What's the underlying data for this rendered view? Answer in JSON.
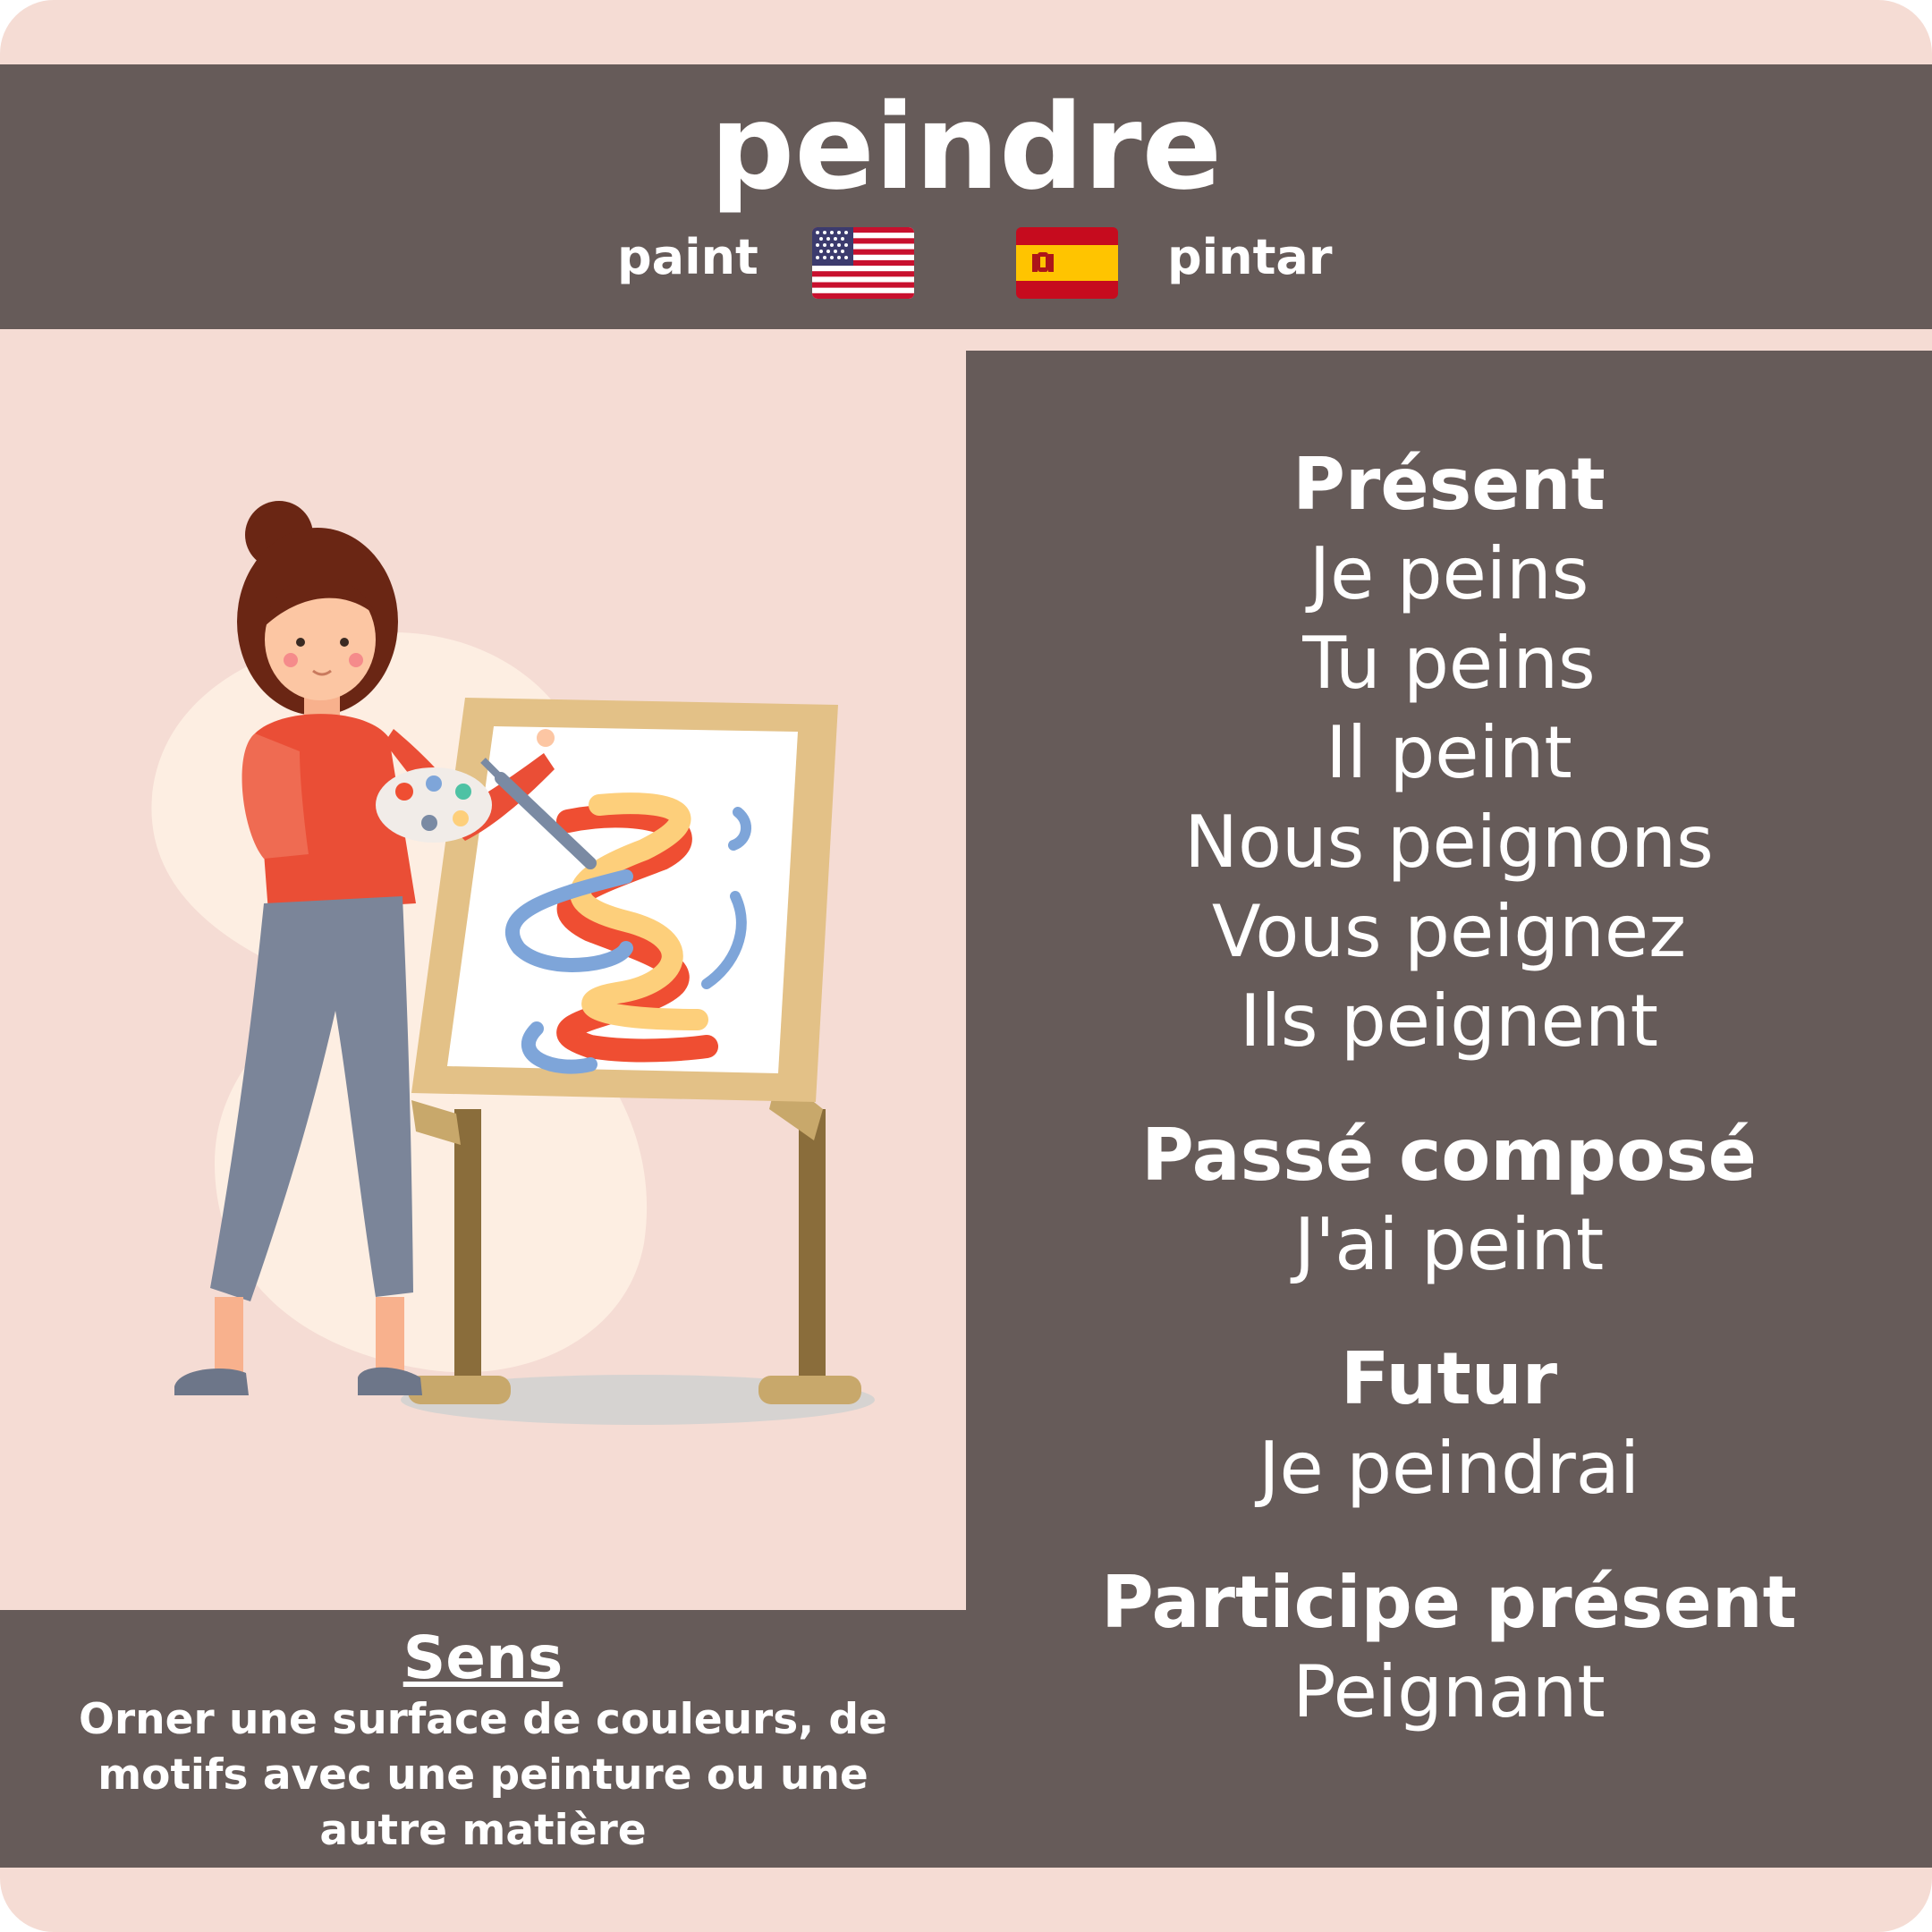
{
  "verb": "peindre",
  "translations": {
    "english": "paint",
    "spanish": "pintar",
    "english_flag_icon": "us-flag-icon",
    "spanish_flag_icon": "spain-flag-icon"
  },
  "conjugations": [
    {
      "tense": "Présent",
      "forms": [
        "Je peins",
        "Tu peins",
        "Il peint",
        "Nous peignons",
        "Vous peignez",
        "Ils peignent"
      ]
    },
    {
      "tense": "Passé composé",
      "forms": [
        "J'ai peint"
      ]
    },
    {
      "tense": "Futur",
      "forms": [
        "Je peindrai"
      ]
    },
    {
      "tense": "Participe présent",
      "forms": [
        "Peignant"
      ]
    }
  ],
  "sens": {
    "title": "Sens",
    "lines": [
      "Orner une surface de couleurs, de",
      "motifs avec une peinture ou une",
      "autre matière"
    ]
  },
  "colors": {
    "card_background": "#f5dcd4",
    "panel": "#665b59",
    "text": "#ffffff"
  },
  "illustration": "woman-painting-at-easel-illustration"
}
